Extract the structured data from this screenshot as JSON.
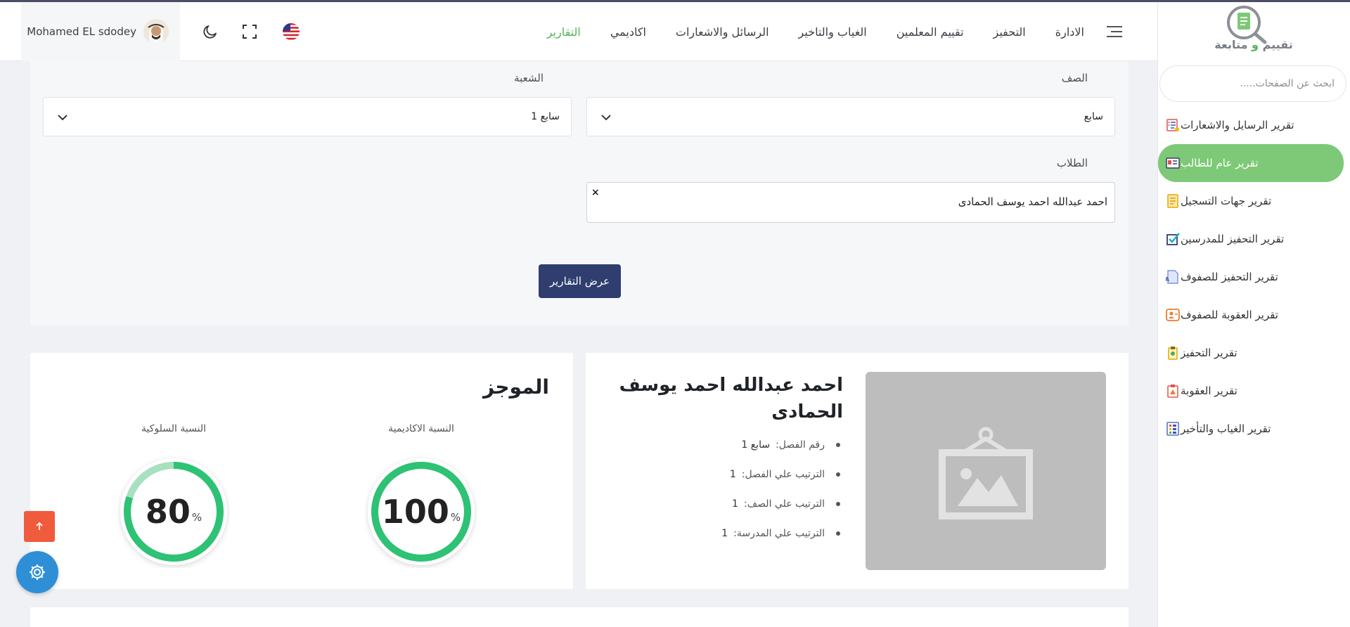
{
  "brand": {
    "logo_text_part1": "تقييم",
    "logo_text_and": "و",
    "logo_text_part2": "متابعة"
  },
  "sidebar": {
    "search_placeholder": "ابحث عن الصفحات.....",
    "items": [
      {
        "label": "تقرير الرسايل والاشعارات",
        "icon": "message-report-icon",
        "active": false
      },
      {
        "label": "تقرير عام للطالب",
        "icon": "student-card-icon",
        "active": true
      },
      {
        "label": "تقرير جهات التسجيل",
        "icon": "document-icon",
        "active": false
      },
      {
        "label": "تقرير التحفيز للمدرسين",
        "icon": "checkbox-icon",
        "active": false
      },
      {
        "label": "تقرير التحفيز للصفوف",
        "icon": "grade-document-icon",
        "active": false
      },
      {
        "label": "تقرير العقوبة للصفوف",
        "icon": "user-penalty-icon",
        "active": false
      },
      {
        "label": "تقرير التحفيز",
        "icon": "award-clipboard-icon",
        "active": false
      },
      {
        "label": "تقرير العقوبة",
        "icon": "warning-clipboard-icon",
        "active": false
      },
      {
        "label": "تقرير الغياب والتأخير",
        "icon": "attendance-grid-icon",
        "active": false
      }
    ]
  },
  "navbar": {
    "user_name": "Mohamed EL sdodey",
    "menu": [
      {
        "label": "الادارة",
        "active": false
      },
      {
        "label": "التحفيز",
        "active": false
      },
      {
        "label": "تقييم المعلمين",
        "active": false
      },
      {
        "label": "الغياب والتاخير",
        "active": false
      },
      {
        "label": "الرسائل والاشعارات",
        "active": false
      },
      {
        "label": "اكاديمي",
        "active": false
      },
      {
        "label": "التقارير",
        "active": true
      }
    ]
  },
  "filters": {
    "grade_label": "الصف",
    "grade_value": "سابع",
    "section_label": "الشعبة",
    "section_value": "سابع 1",
    "students_label": "الطلاب",
    "students_value": "احمد عبدالله احمد يوسف الحمادى",
    "remove_symbol": "×",
    "submit_label": "عرض التقارير"
  },
  "student": {
    "name": "احمد عبدالله احمد يوسف الحمادى",
    "stats": [
      {
        "label": "رقم الفصل:",
        "value": "سابع 1"
      },
      {
        "label": "الترتيب علي الفصل:",
        "value": "1"
      },
      {
        "label": "الترتيب علي الصف:",
        "value": "1"
      },
      {
        "label": "الترتيب علي المدرسة:",
        "value": "1"
      }
    ]
  },
  "summary": {
    "title": "الموجز",
    "academic_label": "النسبة الاكاديمية",
    "academic_value": "100",
    "academic_fraction": 1.0,
    "behavior_label": "النسبة السلوكية",
    "behavior_value": "80",
    "behavior_fraction": 0.8,
    "percent_sign": "%"
  },
  "colors": {
    "accent_green": "#55b25b",
    "sidebar_active": "#7dc977",
    "ring_green": "#2ec274",
    "ring_light": "#a8e0c0",
    "button_navy": "#2f3e6e",
    "fab_orange": "#ef5b3c",
    "fab_blue": "#2f8fd6"
  }
}
